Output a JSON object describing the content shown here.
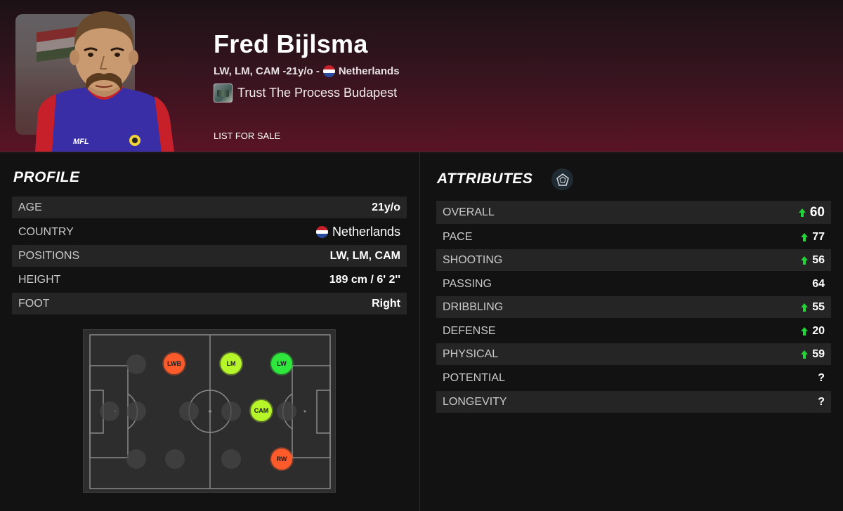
{
  "player": {
    "name": "Fred Bijlsma",
    "positions_age": "LW, LM, CAM -21y/o -",
    "nationality": "Netherlands",
    "club": "Trust The Process Budapest",
    "badge_text": "MFL"
  },
  "actions": {
    "list_for_sale": "LIST FOR SALE"
  },
  "profile": {
    "title": "PROFILE",
    "rows": [
      {
        "label": "AGE",
        "value": "21y/o"
      },
      {
        "label": "COUNTRY",
        "value": "Netherlands"
      },
      {
        "label": "POSITIONS",
        "value": "LW, LM, CAM"
      },
      {
        "label": "HEIGHT",
        "value": "189 cm / 6' 2''"
      },
      {
        "label": "FOOT",
        "value": "Right"
      }
    ]
  },
  "pitch": {
    "positions": [
      {
        "label": "LWB",
        "color": "#ff5a2a"
      },
      {
        "label": "LM",
        "color": "#b6f52a"
      },
      {
        "label": "LW",
        "color": "#2ee63c"
      },
      {
        "label": "CAM",
        "color": "#b6f52a"
      },
      {
        "label": "RW",
        "color": "#ff5a2a"
      }
    ]
  },
  "attributes": {
    "title": "ATTRIBUTES",
    "rows": [
      {
        "label": "OVERALL",
        "value": "60",
        "up": true
      },
      {
        "label": "PACE",
        "value": "77",
        "up": true
      },
      {
        "label": "SHOOTING",
        "value": "56",
        "up": true
      },
      {
        "label": "PASSING",
        "value": "64",
        "up": false
      },
      {
        "label": "DRIBBLING",
        "value": "55",
        "up": true
      },
      {
        "label": "DEFENSE",
        "value": "20",
        "up": true
      },
      {
        "label": "PHYSICAL",
        "value": "59",
        "up": true
      },
      {
        "label": "POTENTIAL",
        "value": "?",
        "up": false
      },
      {
        "label": "LONGEVITY",
        "value": "?",
        "up": false
      }
    ]
  },
  "colors": {
    "up_arrow": "#22d63a",
    "header_accent": "#5a1424"
  }
}
